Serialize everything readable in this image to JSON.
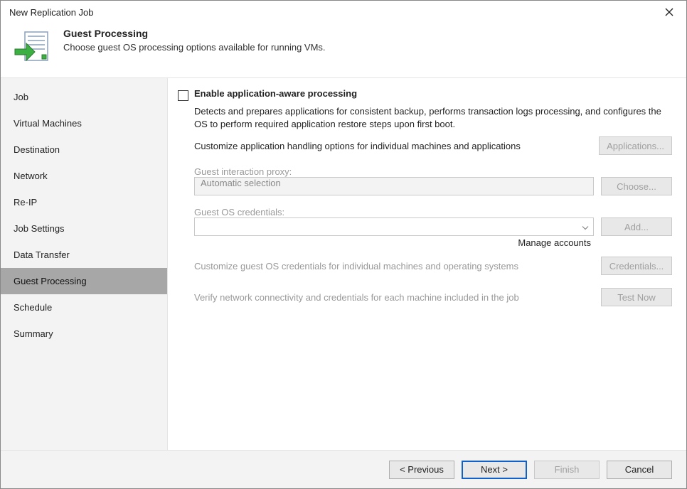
{
  "window": {
    "title": "New Replication Job",
    "close_icon": "close"
  },
  "header": {
    "title": "Guest Processing",
    "subtitle": "Choose guest OS processing options available for running VMs."
  },
  "sidebar": {
    "items": [
      {
        "label": "Job",
        "active": false
      },
      {
        "label": "Virtual Machines",
        "active": false
      },
      {
        "label": "Destination",
        "active": false
      },
      {
        "label": "Network",
        "active": false
      },
      {
        "label": "Re-IP",
        "active": false
      },
      {
        "label": "Job Settings",
        "active": false
      },
      {
        "label": "Data Transfer",
        "active": false
      },
      {
        "label": "Guest Processing",
        "active": true
      },
      {
        "label": "Schedule",
        "active": false
      },
      {
        "label": "Summary",
        "active": false
      }
    ]
  },
  "content": {
    "enable_app_aware": {
      "checked": false,
      "label": "Enable application-aware processing",
      "desc": "Detects and prepares applications for consistent backup, performs transaction logs processing, and configures the OS to perform required application restore steps upon first boot.",
      "customize_text": "Customize application handling options for individual machines and applications",
      "applications_btn": "Applications..."
    },
    "proxy": {
      "label": "Guest interaction proxy:",
      "value": "Automatic selection",
      "choose_btn": "Choose..."
    },
    "credentials": {
      "label": "Guest OS credentials:",
      "value": "",
      "add_btn": "Add...",
      "manage_link": "Manage accounts"
    },
    "customize_creds": {
      "text": "Customize guest OS credentials for individual machines and operating systems",
      "btn": "Credentials..."
    },
    "verify": {
      "text": "Verify network connectivity and credentials for each machine included in the job",
      "btn": "Test Now"
    }
  },
  "footer": {
    "previous": "< Previous",
    "next": "Next >",
    "finish": "Finish",
    "cancel": "Cancel"
  }
}
